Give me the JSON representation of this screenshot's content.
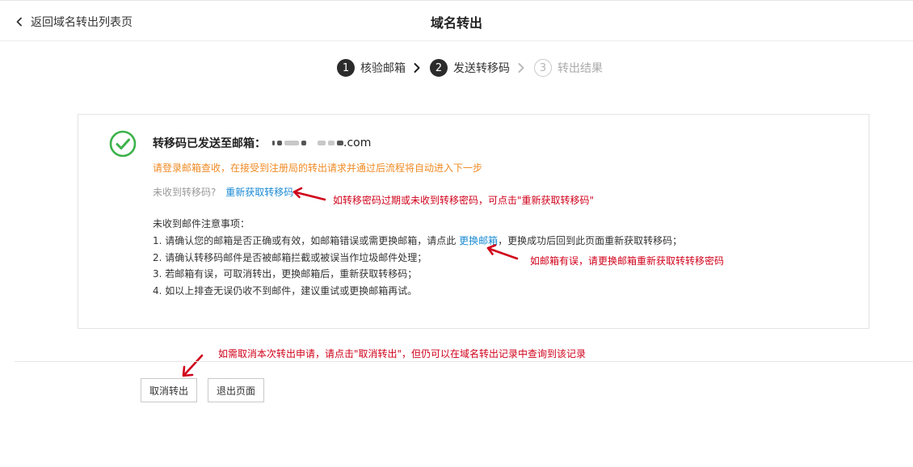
{
  "header": {
    "back_label": "返回域名转出列表页",
    "title": "域名转出"
  },
  "steps": [
    {
      "num": "1",
      "label": "核验邮箱",
      "state": "active"
    },
    {
      "num": "2",
      "label": "发送转移码",
      "state": "active"
    },
    {
      "num": "3",
      "label": "转出结果",
      "state": "inactive"
    }
  ],
  "card": {
    "sent_label": "转移码已发送至邮箱：",
    "email_domain": ".com",
    "notice": "请登录邮箱查收，在接受到注册局的转出请求并通过后流程将自动进入下一步",
    "resend_question": "未收到转移码?",
    "resend_link": "重新获取转移码",
    "tips_title": "未收到邮件注意事项：",
    "tip1_pre": "1. 请确认您的邮箱是否正确或有效，如邮箱错误或需更换邮箱，请点此 ",
    "tip1_link": "更换邮箱",
    "tip1_post": "，更换成功后回到此页面重新获取转移码；",
    "tip2": "2. 请确认转移码邮件是否被邮箱拦截或被误当作垃圾邮件处理；",
    "tip3": "3. 若邮箱有误，可取消转出，更换邮箱后，重新获取转移码；",
    "tip4": "4. 如以上排查无误仍收不到邮件，建议重试或更换邮箱再试。"
  },
  "annotations": {
    "resend": "如转移密码过期或未收到转移密码，可点击\"重新获取转移码\"",
    "change_email": "如邮箱有误，请更换邮箱重新获取转转移密码",
    "cancel": "如需取消本次转出申请，请点击\"取消转出\"，但仍可以在域名转出记录中查询到该记录"
  },
  "buttons": {
    "cancel": "取消转出",
    "exit": "退出页面"
  },
  "colors": {
    "accent_link": "#1a8ad4",
    "notice_orange": "#f08a24",
    "annotation_red": "#d0021b",
    "success_green": "#3cb24a"
  }
}
